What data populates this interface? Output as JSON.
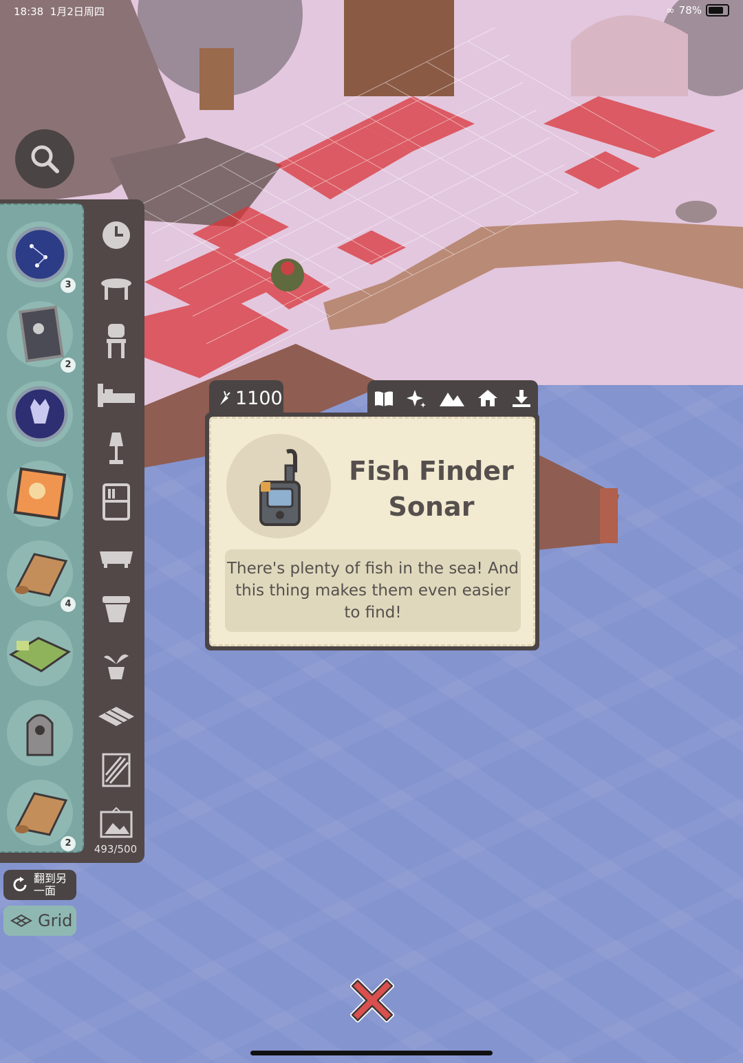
{
  "status_bar": {
    "time": "18:38",
    "date": "1月2日周四",
    "battery": "78%"
  },
  "search": {
    "icon": "search-icon"
  },
  "inventory": {
    "items": [
      {
        "name": "constellation-round-item",
        "badge": "3"
      },
      {
        "name": "framed-poster-item",
        "badge": "2"
      },
      {
        "name": "dog-portrait-round-item",
        "badge": ""
      },
      {
        "name": "orange-painting-item",
        "badge": ""
      },
      {
        "name": "wood-roll-item",
        "badge": "4"
      },
      {
        "name": "green-bed-item",
        "badge": ""
      },
      {
        "name": "skull-gravestone-item",
        "badge": ""
      },
      {
        "name": "wood-roll-item-2",
        "badge": "2"
      }
    ],
    "count": "493/500"
  },
  "categories": [
    "clock-icon",
    "table-icon",
    "chair-icon",
    "bed-icon",
    "lamp-icon",
    "shelf-icon",
    "bathtub-icon",
    "pot-icon",
    "plant-icon",
    "floor-icon",
    "wallpaper-icon",
    "picture-icon"
  ],
  "controls": {
    "flip_label": "翻到另一面",
    "grid_label": "Grid"
  },
  "tooltip": {
    "price": "1100",
    "tabs": [
      "book-icon",
      "sparkle-icon",
      "mountain-icon",
      "home-icon",
      "download-icon"
    ],
    "title": "Fish Finder Sonar",
    "description": "There's plenty of fish in the sea! And this thing makes them even easier to find!"
  },
  "colors": {
    "panel": "#514847",
    "panel_items": "#7ca7a2",
    "water": "#8494cf",
    "ground": "#e3c7de",
    "tooltip_bg": "#f3ead2",
    "close_red": "#d9504f"
  }
}
